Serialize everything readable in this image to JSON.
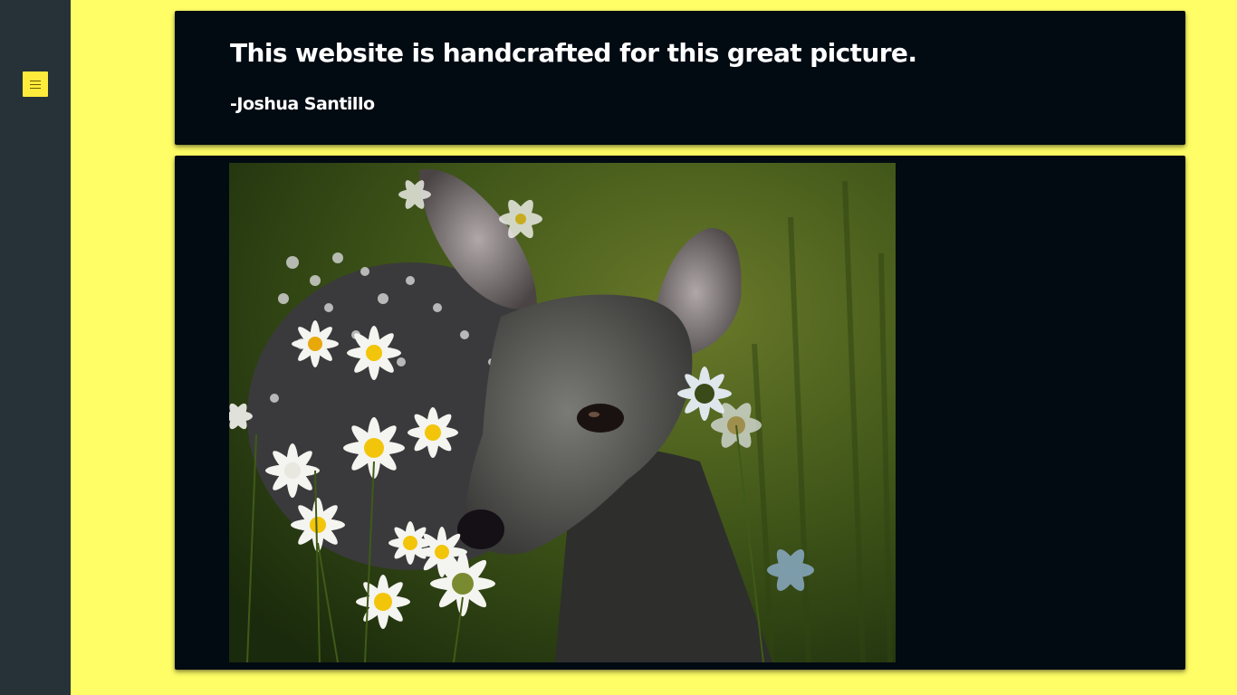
{
  "sidebar": {
    "menu_button": {
      "icon": "hamburger-menu-icon",
      "color": "#ffeb3b"
    }
  },
  "header": {
    "title": "This website is handcrafted for this great picture.",
    "attribution": "-Joshua Santillo"
  },
  "colors": {
    "page_background": "#ffff66",
    "sidebar_background": "#263238",
    "card_background": "#020a12",
    "text": "#ffffff"
  }
}
